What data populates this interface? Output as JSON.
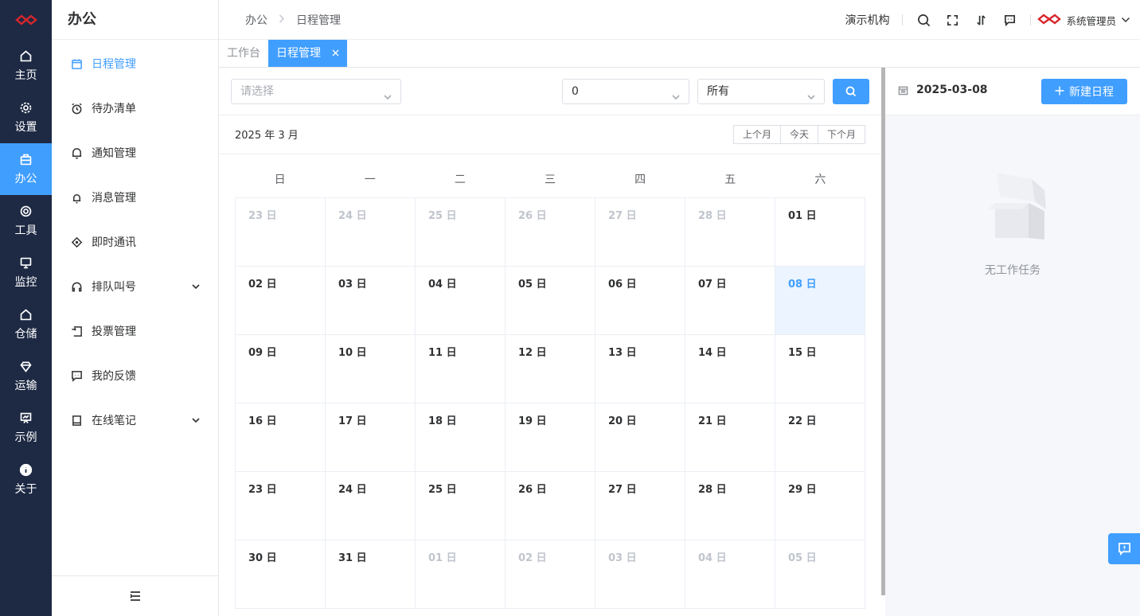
{
  "rail": {
    "items": [
      {
        "label": "主页",
        "icon": "home-icon"
      },
      {
        "label": "设置",
        "icon": "gear-icon"
      },
      {
        "label": "办公",
        "icon": "briefcase-icon"
      },
      {
        "label": "工具",
        "icon": "lifebuoy-icon"
      },
      {
        "label": "监控",
        "icon": "monitor-icon"
      },
      {
        "label": "仓储",
        "icon": "warehouse-icon"
      },
      {
        "label": "运输",
        "icon": "diamond-icon"
      },
      {
        "label": "示例",
        "icon": "presentation-icon"
      },
      {
        "label": "关于",
        "icon": "info-icon"
      }
    ]
  },
  "menu": {
    "title": "办公",
    "items": [
      {
        "label": "日程管理",
        "icon": "calendar-icon"
      },
      {
        "label": "待办清单",
        "icon": "alarm-icon"
      },
      {
        "label": "通知管理",
        "icon": "bell-icon"
      },
      {
        "label": "消息管理",
        "icon": "bell-small-icon"
      },
      {
        "label": "即时通讯",
        "icon": "chat-nodes-icon"
      },
      {
        "label": "排队叫号",
        "icon": "headset-icon"
      },
      {
        "label": "投票管理",
        "icon": "ballot-icon"
      },
      {
        "label": "我的反馈",
        "icon": "feedback-icon"
      },
      {
        "label": "在线笔记",
        "icon": "notebook-icon"
      }
    ]
  },
  "topbar": {
    "breadcrumb": [
      "办公",
      "日程管理"
    ],
    "org": "演示机构",
    "user": "系统管理员"
  },
  "tabs": [
    {
      "label": "工作台"
    },
    {
      "label": "日程管理"
    }
  ],
  "filters": {
    "select1_placeholder": "请选择",
    "select2_value": "0",
    "select3_value": "所有"
  },
  "calendar": {
    "month_title": "2025 年 3 月",
    "prev_label": "上个月",
    "today_label": "今天",
    "next_label": "下个月",
    "weekdays": [
      "日",
      "一",
      "二",
      "三",
      "四",
      "五",
      "六"
    ],
    "weeks": [
      [
        "23 日",
        "24 日",
        "25 日",
        "26 日",
        "27 日",
        "28 日",
        "01 日"
      ],
      [
        "02 日",
        "03 日",
        "04 日",
        "05 日",
        "06 日",
        "07 日",
        "08 日"
      ],
      [
        "09 日",
        "10 日",
        "11 日",
        "12 日",
        "13 日",
        "14 日",
        "15 日"
      ],
      [
        "16 日",
        "17 日",
        "18 日",
        "19 日",
        "20 日",
        "21 日",
        "22 日"
      ],
      [
        "23 日",
        "24 日",
        "25 日",
        "26 日",
        "27 日",
        "28 日",
        "29 日"
      ],
      [
        "30 日",
        "31 日",
        "01 日",
        "02 日",
        "03 日",
        "04 日",
        "05 日"
      ]
    ]
  },
  "side": {
    "date": "2025-03-08",
    "new_button": "新建日程",
    "empty_text": "无工作任务"
  },
  "colors": {
    "primary": "#409eff",
    "rail_bg": "#1e2a44",
    "selected_bg": "#ecf5ff",
    "brand_red": "#d9262c"
  }
}
